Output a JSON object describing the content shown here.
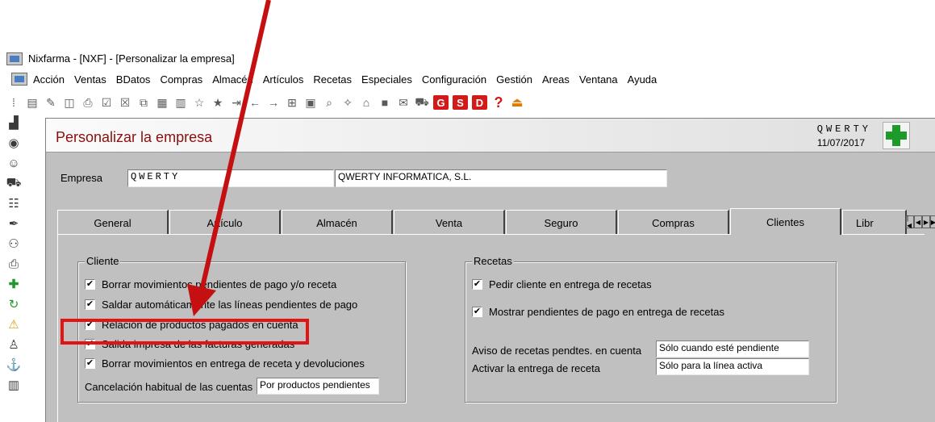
{
  "window": {
    "title": "Nixfarma - [NXF] - [Personalizar la empresa]"
  },
  "menu": [
    "Acción",
    "Ventas",
    "BDatos",
    "Compras",
    "Almacén",
    "Artículos",
    "Recetas",
    "Especiales",
    "Configuración",
    "Gestión",
    "Areas",
    "Ventana",
    "Ayuda"
  ],
  "toolbar": {
    "badges": [
      "G",
      "S",
      "D"
    ],
    "help": "?"
  },
  "header": {
    "title": "Personalizar la empresa",
    "company_code": "QWERTY",
    "date": "11/07/2017"
  },
  "empresa": {
    "label": "Empresa",
    "code": "QWERTY",
    "name": "QWERTY INFORMATICA, S.L."
  },
  "tabs": [
    "General",
    "Artículo",
    "Almacén",
    "Venta",
    "Seguro",
    "Compras",
    "Clientes",
    "Libr"
  ],
  "active_tab": "Clientes",
  "cliente": {
    "legend": "Cliente",
    "options": [
      {
        "label": "Borrar movimientos pendientes de pago y/o receta",
        "checked": true
      },
      {
        "label": "Saldar automáticamente las líneas pendientes de pago",
        "checked": true
      },
      {
        "label": "Relación de productos pagados en cuenta",
        "checked": true
      },
      {
        "label": "Salida impresa de las facturas generadas",
        "checked": true
      },
      {
        "label": "Borrar movimientos en entrega de receta y devoluciones",
        "checked": true
      }
    ],
    "cancelacion_label": "Cancelación habitual de las cuentas",
    "cancelacion_value": "Por productos pendientes"
  },
  "recetas": {
    "legend": "Recetas",
    "options": [
      {
        "label": "Pedir cliente en entrega de recetas",
        "checked": true
      },
      {
        "label": "Mostrar pendientes de pago en entrega de recetas",
        "checked": true
      }
    ],
    "aviso_label": "Aviso de recetas pendtes. en cuenta",
    "aviso_value": "Sólo cuando esté pendiente",
    "activar_label": "Activar la entrega de receta",
    "activar_value": "Sólo para la línea activa"
  },
  "colors": {
    "title_red": "#8b0d0d",
    "annotation_red": "#e01414",
    "panel_gray": "#c0c0c0",
    "cross_green": "#1e9a2a"
  }
}
